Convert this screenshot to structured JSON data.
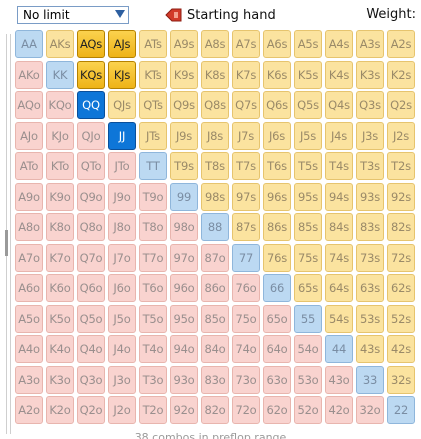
{
  "toolbar": {
    "limit_select": {
      "value": "No limit"
    },
    "starting_hand_label": "Starting hand",
    "weight_label": "Weight:"
  },
  "hands": [
    [
      "AA",
      "AKs",
      "AQs",
      "AJs",
      "ATs",
      "A9s",
      "A8s",
      "A7s",
      "A6s",
      "A5s",
      "A4s",
      "A3s",
      "A2s"
    ],
    [
      "AKo",
      "KK",
      "KQs",
      "KJs",
      "KTs",
      "K9s",
      "K8s",
      "K7s",
      "K6s",
      "K5s",
      "K4s",
      "K3s",
      "K2s"
    ],
    [
      "AQo",
      "KQo",
      "QQ",
      "QJs",
      "QTs",
      "Q9s",
      "Q8s",
      "Q7s",
      "Q6s",
      "Q5s",
      "Q4s",
      "Q3s",
      "Q2s"
    ],
    [
      "AJo",
      "KJo",
      "QJo",
      "JJ",
      "JTs",
      "J9s",
      "J8s",
      "J7s",
      "J6s",
      "J5s",
      "J4s",
      "J3s",
      "J2s"
    ],
    [
      "ATo",
      "KTo",
      "QTo",
      "JTo",
      "TT",
      "T9s",
      "T8s",
      "T7s",
      "T6s",
      "T5s",
      "T4s",
      "T3s",
      "T2s"
    ],
    [
      "A9o",
      "K9o",
      "Q9o",
      "J9o",
      "T9o",
      "99",
      "98s",
      "97s",
      "96s",
      "95s",
      "94s",
      "93s",
      "92s"
    ],
    [
      "A8o",
      "K8o",
      "Q8o",
      "J8o",
      "T8o",
      "98o",
      "88",
      "87s",
      "86s",
      "85s",
      "84s",
      "83s",
      "82s"
    ],
    [
      "A7o",
      "K7o",
      "Q7o",
      "J7o",
      "T7o",
      "97o",
      "87o",
      "77",
      "76s",
      "75s",
      "74s",
      "73s",
      "72s"
    ],
    [
      "A6o",
      "K6o",
      "Q6o",
      "J6o",
      "T6o",
      "96o",
      "86o",
      "76o",
      "66",
      "65s",
      "64s",
      "63s",
      "62s"
    ],
    [
      "A5o",
      "K5o",
      "Q5o",
      "J5o",
      "T5o",
      "95o",
      "85o",
      "75o",
      "65o",
      "55",
      "54s",
      "53s",
      "52s"
    ],
    [
      "A4o",
      "K4o",
      "Q4o",
      "J4o",
      "T4o",
      "94o",
      "84o",
      "74o",
      "64o",
      "54o",
      "44",
      "43s",
      "42s"
    ],
    [
      "A3o",
      "K3o",
      "Q3o",
      "J3o",
      "T3o",
      "93o",
      "83o",
      "73o",
      "63o",
      "53o",
      "43o",
      "33",
      "32s"
    ],
    [
      "A2o",
      "K2o",
      "Q2o",
      "J2o",
      "T2o",
      "92o",
      "82o",
      "72o",
      "62o",
      "52o",
      "42o",
      "32o",
      "22"
    ]
  ],
  "selected_hands": [
    "AQs",
    "AJs",
    "KQs",
    "KJs",
    "QQ",
    "JJ"
  ],
  "status_text": "38 combos in preflop range",
  "colors": {
    "offsuit_bg": "#f9d3cf",
    "suited_bg": "#fbe39f",
    "pair_bg": "#bcd9f2",
    "selected_suited_bg": "#f5c22e",
    "selected_pair_bg": "#0e76d8"
  },
  "icons": {
    "limit_dropdown": "chevron-down-icon",
    "starting_hand": "red-flag-arrow-icon"
  }
}
